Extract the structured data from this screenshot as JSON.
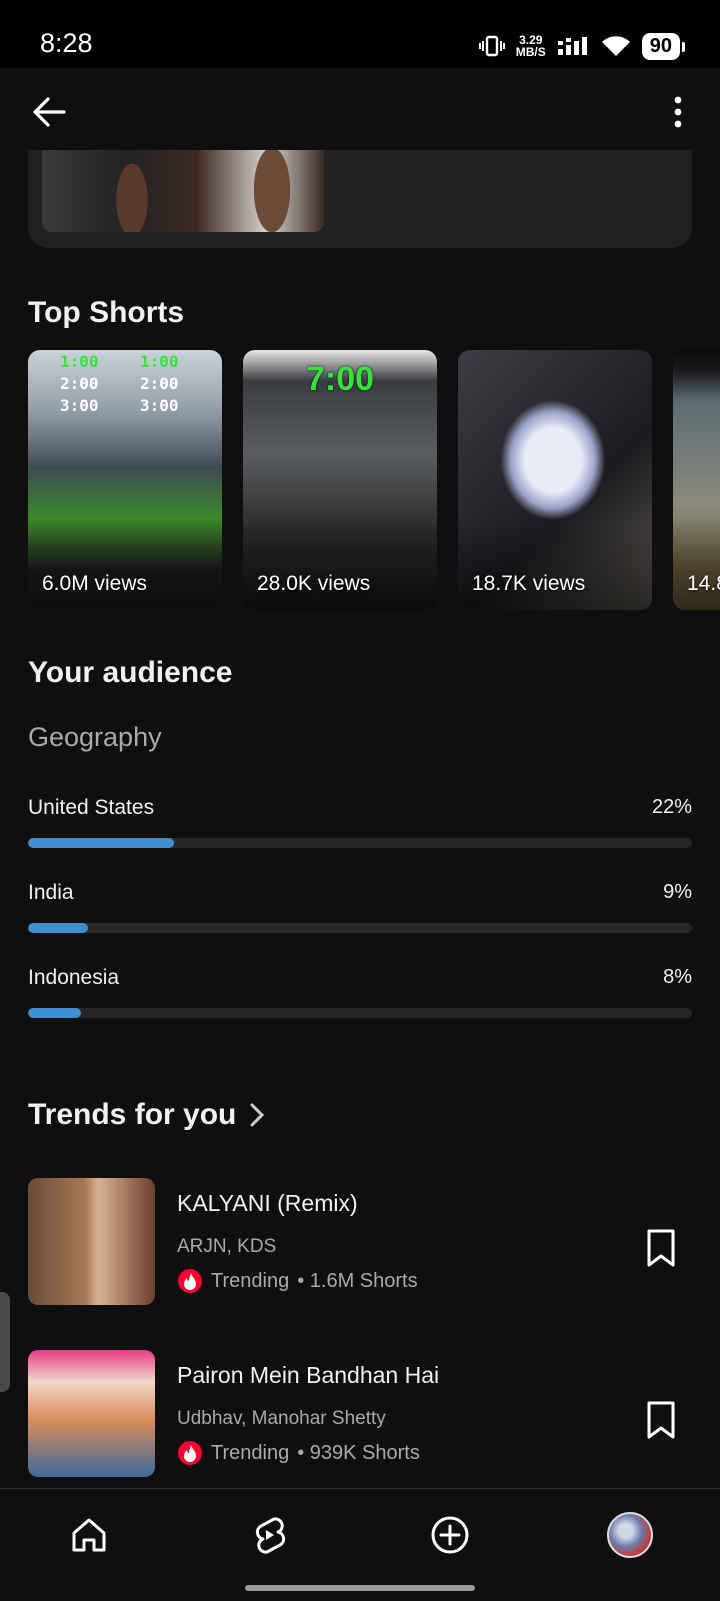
{
  "status": {
    "time": "8:28",
    "speed_value": "3.29",
    "speed_unit": "MB/S",
    "battery": "90"
  },
  "top_shorts": {
    "title": "Top Shorts",
    "items": [
      {
        "views": "6.0M views"
      },
      {
        "views": "28.0K views"
      },
      {
        "views": "18.7K views"
      },
      {
        "views": "14.8"
      }
    ]
  },
  "audience": {
    "title": "Your audience",
    "geography": {
      "title": "Geography",
      "rows": [
        {
          "country": "United States",
          "percent_label": "22%",
          "percent": 22
        },
        {
          "country": "India",
          "percent_label": "9%",
          "percent": 9
        },
        {
          "country": "Indonesia",
          "percent_label": "8%",
          "percent": 8
        }
      ]
    }
  },
  "trends": {
    "title": "Trends for you",
    "items": [
      {
        "title": "KALYANI (Remix)",
        "artists": "ARJN, KDS",
        "status": "Trending",
        "count": "• 1.6M Shorts"
      },
      {
        "title": "Pairon Mein Bandhan Hai",
        "artists": "Udbhav, Manohar Shetty",
        "status": "Trending",
        "count": "• 939K Shorts"
      }
    ]
  },
  "colors": {
    "accent": "#3e8ed0",
    "background": "#0f0f0f",
    "trending": "#ff0033"
  }
}
